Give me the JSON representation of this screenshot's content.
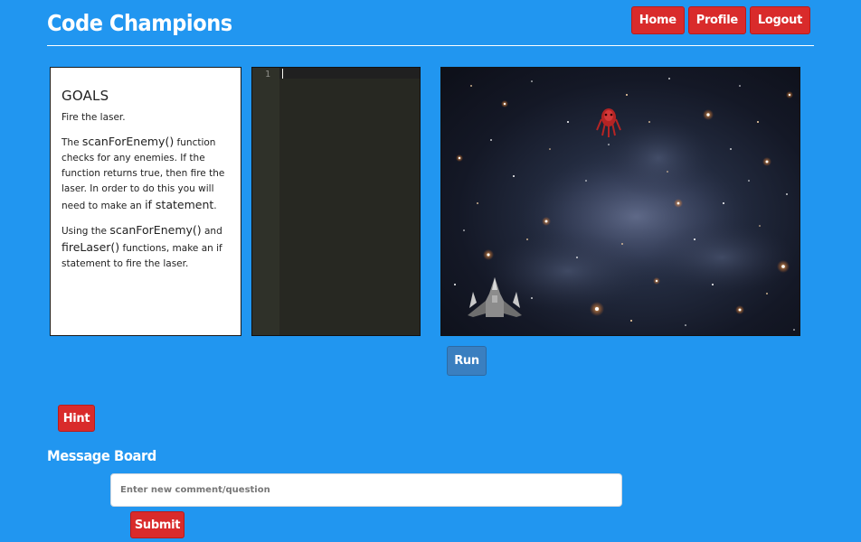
{
  "header": {
    "brand": "Code Champions",
    "nav": [
      {
        "label": "Home"
      },
      {
        "label": "Profile"
      },
      {
        "label": "Logout"
      }
    ]
  },
  "goals": {
    "title": "GOALS",
    "intro": "Fire the laser.",
    "p1": {
      "prefix": "The ",
      "fn": "scanForEnemy()",
      "rest": " function checks for any enemies. If the function returns true, then fire the laser. In order to do this you will need to make an ",
      "kw": "if statement",
      "end": "."
    },
    "p2": {
      "prefix": "Using the ",
      "fn1": "scanForEnemy()",
      "mid": " and ",
      "fn2": "fireLaser()",
      "rest": " functions, make an if statement to fire the laser."
    }
  },
  "editor": {
    "line_number": "1"
  },
  "game": {
    "player_icon": "spaceship-icon",
    "enemy_icon": "alien-enemy-icon",
    "colors": {
      "space": "#1a1f2e",
      "enemy": "#b52424",
      "ship": "#9a9a9a"
    }
  },
  "run_label": "Run",
  "hint_label": "Hint",
  "message_board": {
    "title": "Message Board",
    "placeholder": "Enter new comment/question",
    "submit_label": "Submit"
  },
  "colors": {
    "background": "#2196f0",
    "button_red": "#d92b2b",
    "run_button": "#3a7fc0"
  }
}
